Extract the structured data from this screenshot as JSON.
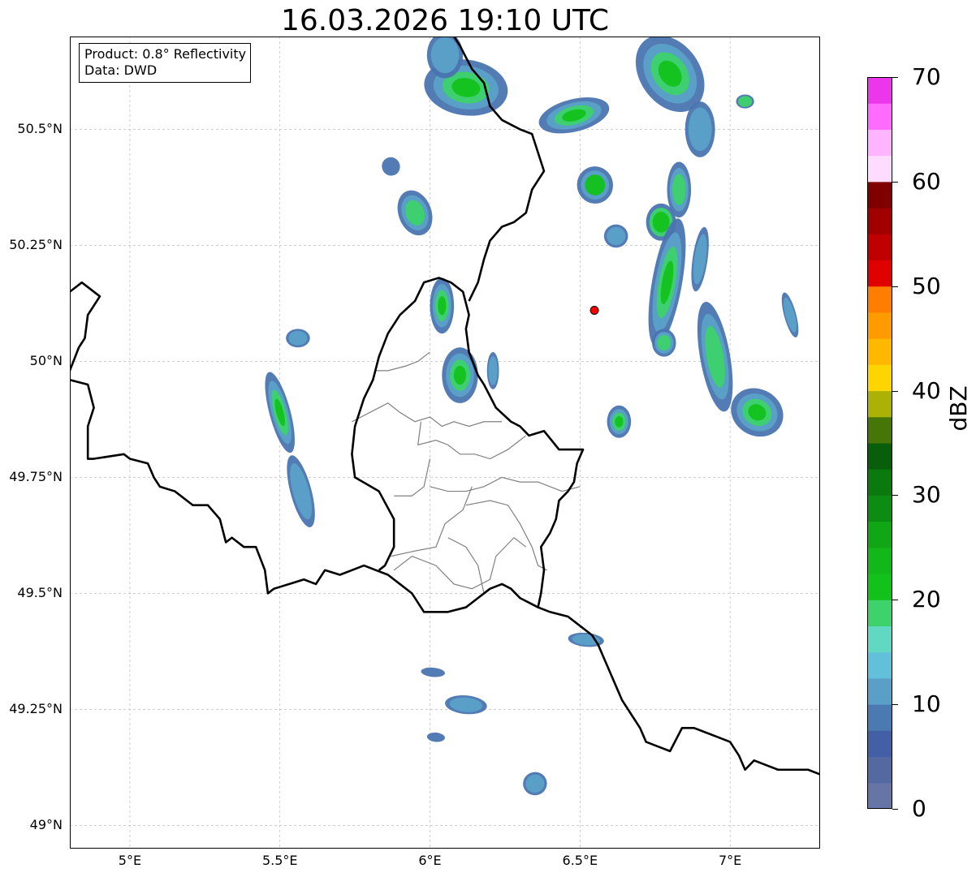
{
  "title": "16.03.2026 19:10 UTC",
  "info": {
    "product": "Product: 0.8° Reflectivity",
    "data": "Data: DWD"
  },
  "map": {
    "extent": {
      "lon_min": 4.8,
      "lon_max": 7.3,
      "lat_min": 48.95,
      "lat_max": 50.7
    },
    "lat_ticks": [
      {
        "value": 50.5,
        "label": "50.5°N"
      },
      {
        "value": 50.25,
        "label": "50.25°N"
      },
      {
        "value": 50.0,
        "label": "50°N"
      },
      {
        "value": 49.75,
        "label": "49.75°N"
      },
      {
        "value": 49.5,
        "label": "49.5°N"
      },
      {
        "value": 49.25,
        "label": "49.25°N"
      },
      {
        "value": 49.0,
        "label": "49°N"
      }
    ],
    "lon_ticks": [
      {
        "value": 5.0,
        "label": "5°E"
      },
      {
        "value": 5.5,
        "label": "5.5°E"
      },
      {
        "value": 6.0,
        "label": "6°E"
      },
      {
        "value": 6.5,
        "label": "6.5°E"
      },
      {
        "value": 7.0,
        "label": "7°E"
      }
    ],
    "radar_site": {
      "lon": 6.548,
      "lat": 50.11,
      "color": "#ff0000"
    },
    "borders": [
      [
        [
          4.8,
          50.15
        ],
        [
          4.84,
          50.17
        ],
        [
          4.9,
          50.14
        ],
        [
          4.86,
          50.1
        ],
        [
          4.85,
          50.05
        ],
        [
          4.83,
          50.03
        ],
        [
          4.8,
          49.98
        ]
      ],
      [
        [
          4.8,
          49.96
        ],
        [
          4.86,
          49.95
        ],
        [
          4.88,
          49.9
        ],
        [
          4.86,
          49.86
        ],
        [
          4.86,
          49.79
        ],
        [
          4.88,
          49.79
        ],
        [
          4.98,
          49.8
        ],
        [
          5.0,
          49.79
        ],
        [
          5.06,
          49.78
        ],
        [
          5.08,
          49.75
        ],
        [
          5.1,
          49.73
        ],
        [
          5.15,
          49.72
        ],
        [
          5.21,
          49.69
        ],
        [
          5.26,
          49.69
        ],
        [
          5.3,
          49.66
        ],
        [
          5.32,
          49.61
        ],
        [
          5.34,
          49.62
        ],
        [
          5.38,
          49.6
        ],
        [
          5.42,
          49.6
        ],
        [
          5.45,
          49.55
        ],
        [
          5.46,
          49.5
        ],
        [
          5.48,
          49.51
        ],
        [
          5.53,
          49.52
        ],
        [
          5.58,
          49.53
        ],
        [
          5.62,
          49.52
        ],
        [
          5.65,
          49.55
        ],
        [
          5.7,
          49.54
        ],
        [
          5.74,
          49.55
        ],
        [
          5.78,
          49.56
        ],
        [
          5.82,
          49.55
        ],
        [
          5.86,
          49.54
        ],
        [
          5.9,
          49.52
        ],
        [
          5.94,
          49.5
        ],
        [
          5.98,
          49.46
        ],
        [
          6.02,
          49.46
        ],
        [
          6.06,
          49.46
        ],
        [
          6.12,
          49.47
        ],
        [
          6.16,
          49.49
        ],
        [
          6.2,
          49.51
        ],
        [
          6.24,
          49.52
        ],
        [
          6.27,
          49.51
        ],
        [
          6.3,
          49.49
        ],
        [
          6.33,
          49.48
        ],
        [
          6.36,
          49.47
        ],
        [
          6.4,
          49.46
        ],
        [
          6.46,
          49.45
        ],
        [
          6.5,
          49.43
        ],
        [
          6.54,
          49.41
        ],
        [
          6.56,
          49.39
        ],
        [
          6.58,
          49.36
        ],
        [
          6.6,
          49.33
        ],
        [
          6.62,
          49.3
        ],
        [
          6.64,
          49.27
        ],
        [
          6.67,
          49.24
        ],
        [
          6.7,
          49.21
        ],
        [
          6.72,
          49.18
        ],
        [
          6.76,
          49.17
        ],
        [
          6.8,
          49.16
        ],
        [
          6.84,
          49.21
        ],
        [
          6.88,
          49.21
        ],
        [
          6.92,
          49.2
        ],
        [
          6.96,
          49.19
        ],
        [
          7.0,
          49.18
        ],
        [
          7.03,
          49.15
        ],
        [
          7.05,
          49.12
        ],
        [
          7.08,
          49.14
        ],
        [
          7.12,
          49.13
        ],
        [
          7.16,
          49.12
        ],
        [
          7.2,
          49.12
        ],
        [
          7.26,
          49.12
        ],
        [
          7.3,
          49.11
        ]
      ],
      [
        [
          6.36,
          49.47
        ],
        [
          6.37,
          49.5
        ],
        [
          6.38,
          49.55
        ],
        [
          6.37,
          49.6
        ],
        [
          6.4,
          49.63
        ],
        [
          6.42,
          49.66
        ],
        [
          6.43,
          49.7
        ],
        [
          6.46,
          49.72
        ],
        [
          6.48,
          49.74
        ],
        [
          6.49,
          49.78
        ],
        [
          6.51,
          49.81
        ],
        [
          6.48,
          49.81
        ],
        [
          6.43,
          49.81
        ],
        [
          6.38,
          49.85
        ],
        [
          6.33,
          49.84
        ],
        [
          6.3,
          49.86
        ],
        [
          6.27,
          49.87
        ],
        [
          6.22,
          49.9
        ],
        [
          6.18,
          49.95
        ],
        [
          6.16,
          49.97
        ],
        [
          6.13,
          50.02
        ],
        [
          6.12,
          50.07
        ],
        [
          6.13,
          50.1
        ],
        [
          6.11,
          50.15
        ],
        [
          6.07,
          50.17
        ],
        [
          6.03,
          50.18
        ],
        [
          5.98,
          50.17
        ],
        [
          5.95,
          50.13
        ],
        [
          5.9,
          50.1
        ],
        [
          5.86,
          50.06
        ],
        [
          5.83,
          50.01
        ],
        [
          5.81,
          49.96
        ],
        [
          5.78,
          49.92
        ],
        [
          5.75,
          49.86
        ],
        [
          5.74,
          49.8
        ],
        [
          5.75,
          49.75
        ],
        [
          5.83,
          49.72
        ],
        [
          5.88,
          49.66
        ],
        [
          5.88,
          49.6
        ],
        [
          5.85,
          49.56
        ],
        [
          5.83,
          49.55
        ]
      ],
      [
        [
          6.13,
          50.13
        ],
        [
          6.16,
          50.17
        ],
        [
          6.18,
          50.22
        ],
        [
          6.2,
          50.26
        ],
        [
          6.24,
          50.29
        ],
        [
          6.28,
          50.3
        ],
        [
          6.32,
          50.32
        ],
        [
          6.34,
          50.37
        ],
        [
          6.38,
          50.41
        ],
        [
          6.36,
          50.45
        ],
        [
          6.34,
          50.49
        ],
        [
          6.3,
          50.5
        ],
        [
          6.24,
          50.52
        ],
        [
          6.2,
          50.55
        ],
        [
          6.18,
          50.6
        ],
        [
          6.14,
          50.63
        ],
        [
          6.1,
          50.68
        ],
        [
          6.08,
          50.7
        ]
      ]
    ],
    "lux_districts": [
      [
        [
          6.0,
          50.02
        ],
        [
          5.96,
          50.0
        ],
        [
          5.92,
          49.99
        ],
        [
          5.86,
          49.98
        ],
        [
          5.82,
          49.98
        ]
      ],
      [
        [
          5.74,
          49.87
        ],
        [
          5.8,
          49.89
        ],
        [
          5.86,
          49.91
        ],
        [
          5.9,
          49.89
        ],
        [
          5.95,
          49.87
        ],
        [
          6.0,
          49.88
        ],
        [
          6.04,
          49.86
        ],
        [
          6.08,
          49.87
        ],
        [
          6.13,
          49.86
        ],
        [
          6.18,
          49.87
        ],
        [
          6.24,
          49.87
        ]
      ],
      [
        [
          5.97,
          49.87
        ],
        [
          5.96,
          49.82
        ],
        [
          6.02,
          49.83
        ],
        [
          6.06,
          49.82
        ],
        [
          6.1,
          49.8
        ],
        [
          6.15,
          49.8
        ],
        [
          6.2,
          49.79
        ],
        [
          6.26,
          49.81
        ],
        [
          6.32,
          49.84
        ]
      ],
      [
        [
          6.0,
          49.79
        ],
        [
          5.98,
          49.73
        ],
        [
          5.94,
          49.71
        ],
        [
          5.88,
          49.71
        ]
      ],
      [
        [
          6.0,
          49.73
        ],
        [
          6.06,
          49.72
        ],
        [
          6.12,
          49.72
        ],
        [
          6.18,
          49.73
        ],
        [
          6.24,
          49.75
        ],
        [
          6.3,
          49.74
        ],
        [
          6.36,
          49.74
        ],
        [
          6.44,
          49.72
        ],
        [
          6.5,
          49.73
        ]
      ],
      [
        [
          6.14,
          49.73
        ],
        [
          6.11,
          49.68
        ],
        [
          6.05,
          49.65
        ],
        [
          6.02,
          49.6
        ],
        [
          5.94,
          49.59
        ],
        [
          5.87,
          49.58
        ]
      ],
      [
        [
          6.12,
          49.69
        ],
        [
          6.2,
          49.7
        ],
        [
          6.26,
          49.69
        ],
        [
          6.3,
          49.65
        ],
        [
          6.34,
          49.6
        ],
        [
          6.36,
          49.56
        ],
        [
          6.39,
          49.55
        ]
      ],
      [
        [
          6.06,
          49.62
        ],
        [
          6.12,
          49.6
        ],
        [
          6.16,
          49.56
        ],
        [
          6.18,
          49.5
        ]
      ],
      [
        [
          5.88,
          49.55
        ],
        [
          5.94,
          49.58
        ],
        [
          6.02,
          49.56
        ],
        [
          6.08,
          49.52
        ],
        [
          6.14,
          49.51
        ],
        [
          6.2,
          49.53
        ],
        [
          6.22,
          49.58
        ],
        [
          6.28,
          49.62
        ],
        [
          6.32,
          49.6
        ]
      ]
    ],
    "cells": [
      {
        "lon": 6.12,
        "lat": 50.59,
        "rx": 0.14,
        "ry": 0.06,
        "rot": 8,
        "layers": [
          "#4a74b0",
          "#5ba1c8",
          "#3dd26c",
          "#12c21a"
        ]
      },
      {
        "lon": 6.05,
        "lat": 50.66,
        "rx": 0.06,
        "ry": 0.05,
        "rot": 0,
        "layers": [
          "#4a74b0",
          "#5ba1c8"
        ]
      },
      {
        "lon": 6.48,
        "lat": 50.53,
        "rx": 0.12,
        "ry": 0.035,
        "rot": -14,
        "layers": [
          "#4a74b0",
          "#5ba1c8",
          "#3dd26c",
          "#12c21a"
        ]
      },
      {
        "lon": 6.8,
        "lat": 50.62,
        "rx": 0.1,
        "ry": 0.09,
        "rot": -35,
        "layers": [
          "#4a74b0",
          "#5ba1c8",
          "#3dd26c",
          "#12c21a"
        ]
      },
      {
        "lon": 6.9,
        "lat": 50.5,
        "rx": 0.05,
        "ry": 0.06,
        "rot": 0,
        "layers": [
          "#4a74b0",
          "#5ba1c8"
        ]
      },
      {
        "lon": 7.05,
        "lat": 50.56,
        "rx": 0.03,
        "ry": 0.015,
        "rot": 0,
        "layers": [
          "#4a74b0",
          "#3dd26c"
        ]
      },
      {
        "lon": 6.55,
        "lat": 50.38,
        "rx": 0.06,
        "ry": 0.04,
        "rot": -10,
        "layers": [
          "#4a74b0",
          "#5ba1c8",
          "#12c21a"
        ]
      },
      {
        "lon": 6.83,
        "lat": 50.37,
        "rx": 0.04,
        "ry": 0.06,
        "rot": 0,
        "layers": [
          "#4a74b0",
          "#5ba1c8",
          "#3dd26c"
        ]
      },
      {
        "lon": 6.62,
        "lat": 50.27,
        "rx": 0.04,
        "ry": 0.025,
        "rot": 0,
        "layers": [
          "#4a74b0",
          "#5ba1c8"
        ]
      },
      {
        "lon": 6.77,
        "lat": 50.3,
        "rx": 0.05,
        "ry": 0.04,
        "rot": 0,
        "layers": [
          "#4a74b0",
          "#3dd26c",
          "#12c21a"
        ]
      },
      {
        "lon": 6.79,
        "lat": 50.17,
        "rx": 0.05,
        "ry": 0.14,
        "rot": 10,
        "layers": [
          "#4a74b0",
          "#5ba1c8",
          "#3dd26c",
          "#12c21a"
        ]
      },
      {
        "lon": 6.9,
        "lat": 50.22,
        "rx": 0.025,
        "ry": 0.07,
        "rot": 8,
        "layers": [
          "#4a74b0",
          "#5ba1c8"
        ]
      },
      {
        "lon": 5.95,
        "lat": 50.32,
        "rx": 0.055,
        "ry": 0.05,
        "rot": -20,
        "layers": [
          "#4a74b0",
          "#5ba1c8",
          "#3dd26c"
        ]
      },
      {
        "lon": 5.87,
        "lat": 50.42,
        "rx": 0.03,
        "ry": 0.02,
        "rot": -30,
        "layers": [
          "#4a74b0"
        ]
      },
      {
        "lon": 6.04,
        "lat": 50.12,
        "rx": 0.04,
        "ry": 0.06,
        "rot": 0,
        "layers": [
          "#4a74b0",
          "#5ba1c8",
          "#3dd26c",
          "#12c21a"
        ]
      },
      {
        "lon": 6.1,
        "lat": 49.97,
        "rx": 0.06,
        "ry": 0.06,
        "rot": 0,
        "layers": [
          "#4a74b0",
          "#5ba1c8",
          "#3dd26c",
          "#12c21a"
        ]
      },
      {
        "lon": 6.21,
        "lat": 49.98,
        "rx": 0.02,
        "ry": 0.04,
        "rot": 0,
        "layers": [
          "#4a74b0",
          "#5ba1c8"
        ]
      },
      {
        "lon": 5.5,
        "lat": 49.89,
        "rx": 0.035,
        "ry": 0.09,
        "rot": -15,
        "layers": [
          "#4a74b0",
          "#5ba1c8",
          "#3dd26c",
          "#12c21a"
        ]
      },
      {
        "lon": 5.57,
        "lat": 49.72,
        "rx": 0.035,
        "ry": 0.08,
        "rot": -15,
        "layers": [
          "#4a74b0",
          "#5ba1c8"
        ]
      },
      {
        "lon": 5.56,
        "lat": 50.05,
        "rx": 0.04,
        "ry": 0.02,
        "rot": 0,
        "layers": [
          "#4a74b0",
          "#5ba1c8"
        ]
      },
      {
        "lon": 6.63,
        "lat": 49.87,
        "rx": 0.04,
        "ry": 0.035,
        "rot": 0,
        "layers": [
          "#4a74b0",
          "#5ba1c8",
          "#3dd26c",
          "#12c21a"
        ]
      },
      {
        "lon": 6.95,
        "lat": 50.01,
        "rx": 0.05,
        "ry": 0.12,
        "rot": -10,
        "layers": [
          "#4a74b0",
          "#5ba1c8",
          "#3dd26c"
        ]
      },
      {
        "lon": 7.09,
        "lat": 49.89,
        "rx": 0.09,
        "ry": 0.05,
        "rot": 30,
        "layers": [
          "#4a74b0",
          "#5ba1c8",
          "#3dd26c",
          "#12c21a"
        ]
      },
      {
        "lon": 6.78,
        "lat": 50.04,
        "rx": 0.04,
        "ry": 0.03,
        "rot": 0,
        "layers": [
          "#4a74b0",
          "#5ba1c8",
          "#3dd26c"
        ]
      },
      {
        "lon": 7.2,
        "lat": 50.1,
        "rx": 0.02,
        "ry": 0.05,
        "rot": -15,
        "layers": [
          "#4a74b0",
          "#5ba1c8"
        ]
      },
      {
        "lon": 6.52,
        "lat": 49.4,
        "rx": 0.06,
        "ry": 0.015,
        "rot": 5,
        "layers": [
          "#4a74b0",
          "#5ba1c8"
        ]
      },
      {
        "lon": 6.12,
        "lat": 49.26,
        "rx": 0.07,
        "ry": 0.02,
        "rot": 5,
        "layers": [
          "#4a74b0",
          "#5ba1c8"
        ]
      },
      {
        "lon": 6.01,
        "lat": 49.33,
        "rx": 0.04,
        "ry": 0.01,
        "rot": 5,
        "layers": [
          "#4a74b0"
        ]
      },
      {
        "lon": 6.02,
        "lat": 49.19,
        "rx": 0.03,
        "ry": 0.01,
        "rot": 5,
        "layers": [
          "#4a74b0"
        ]
      },
      {
        "lon": 6.35,
        "lat": 49.09,
        "rx": 0.04,
        "ry": 0.025,
        "rot": -10,
        "layers": [
          "#4a74b0",
          "#5ba1c8"
        ]
      }
    ]
  },
  "colorbar": {
    "label": "dBZ",
    "min": 0,
    "max": 70,
    "ticks": [
      0,
      10,
      20,
      30,
      40,
      50,
      60,
      70
    ],
    "colors": [
      "#6674a6",
      "#53699f",
      "#4360a6",
      "#4a7ab1",
      "#5a9fc8",
      "#63c0db",
      "#60d8c2",
      "#3dd26c",
      "#12c21a",
      "#12b81a",
      "#10a616",
      "#0c8c12",
      "#0a7a0f",
      "#085e0a",
      "#477608",
      "#acb106",
      "#ffd500",
      "#ffb800",
      "#ff9b00",
      "#ff7d00",
      "#e00000",
      "#c00000",
      "#a00000",
      "#800000",
      "#ffdcff",
      "#ffb4ff",
      "#ff6bff",
      "#eb36eb"
    ]
  }
}
